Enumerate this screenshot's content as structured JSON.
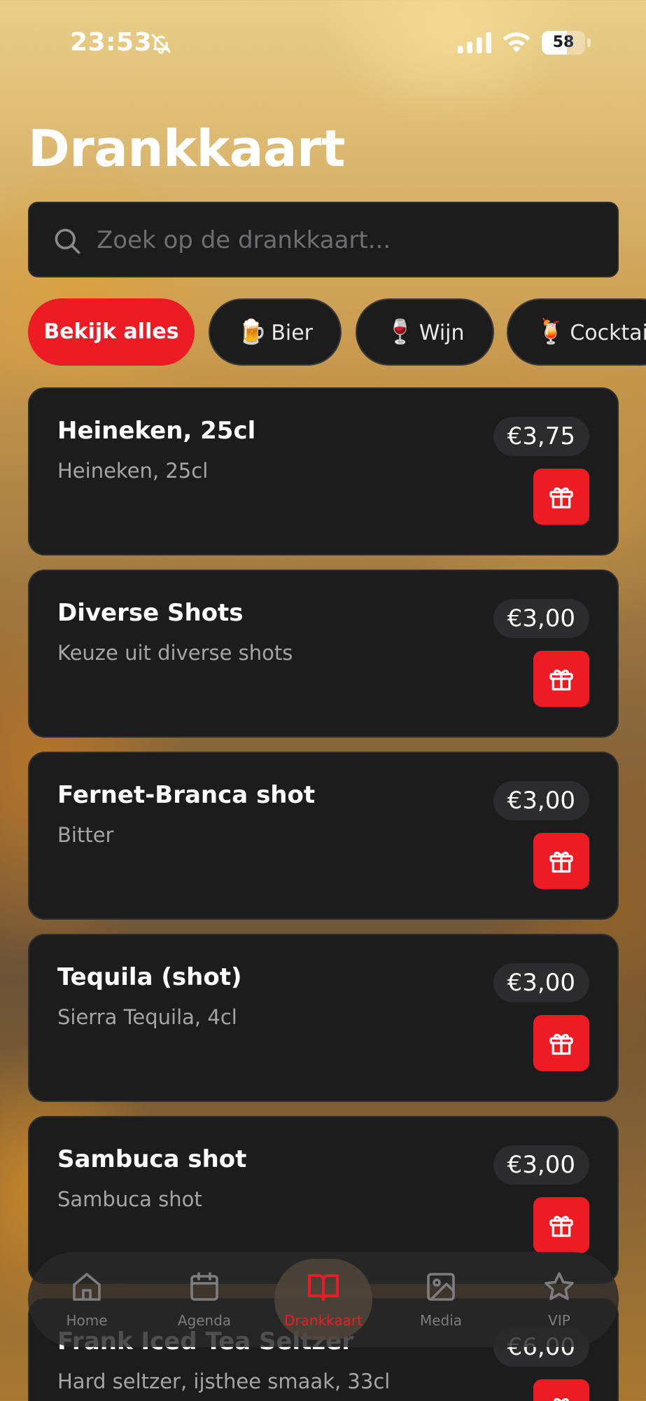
{
  "status_bar": {
    "time": "23:53",
    "battery": "58",
    "battery_level": 0.58
  },
  "page_title": "Drankkaart",
  "search": {
    "placeholder": "Zoek op de drankkaart...",
    "value": ""
  },
  "filters": [
    {
      "label": "Bekijk alles",
      "emoji": "",
      "active": true
    },
    {
      "label": "Bier",
      "emoji": "🍺",
      "active": false
    },
    {
      "label": "Wijn",
      "emoji": "🍷",
      "active": false
    },
    {
      "label": "Cocktai",
      "emoji": "🍹",
      "active": false
    }
  ],
  "items": [
    {
      "name": "Heineken, 25cl",
      "description": "Heineken, 25cl",
      "price": "€3,75"
    },
    {
      "name": "Diverse Shots",
      "description": "Keuze uit diverse shots",
      "price": "€3,00"
    },
    {
      "name": "Fernet-Branca shot",
      "description": "Bitter",
      "price": "€3,00"
    },
    {
      "name": "Tequila (shot)",
      "description": "Sierra Tequila, 4cl",
      "price": "€3,00"
    },
    {
      "name": "Sambuca shot",
      "description": "Sambuca shot",
      "price": "€3,00"
    },
    {
      "name": "Frank Iced Tea Seltzer",
      "description": "Hard seltzer, ijsthee smaak, 33cl",
      "price": "€6,00"
    }
  ],
  "tab_bar": {
    "tabs": [
      {
        "label": "Home",
        "icon": "home-icon",
        "active": false
      },
      {
        "label": "Agenda",
        "icon": "calendar-icon",
        "active": false
      },
      {
        "label": "Drankkaart",
        "icon": "book-icon",
        "active": true
      },
      {
        "label": "Media",
        "icon": "image-icon",
        "active": false
      },
      {
        "label": "VIP",
        "icon": "star-icon",
        "active": false
      }
    ]
  },
  "colors": {
    "accent": "#ed1c24",
    "card": "#1c1c1d",
    "muted_text": "#a5a5a8"
  }
}
